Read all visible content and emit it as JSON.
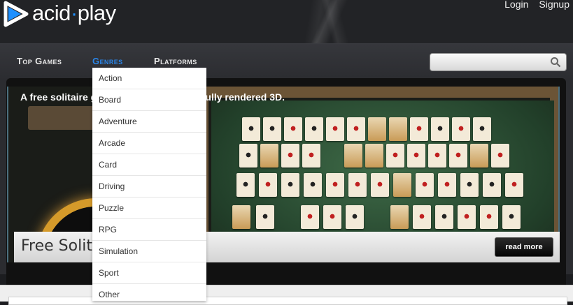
{
  "brand": {
    "name_part1": "acid",
    "name_part2": "play"
  },
  "auth": {
    "login": "Login",
    "signup": "Signup"
  },
  "nav": {
    "items": [
      {
        "label": "Top Games"
      },
      {
        "label": "Genres"
      },
      {
        "label": "Platforms"
      }
    ]
  },
  "search": {
    "placeholder": ""
  },
  "genres_menu": [
    "Action",
    "Board",
    "Adventure",
    "Arcade",
    "Card",
    "Driving",
    "Puzzle",
    "RPG",
    "Simulation",
    "Sport",
    "Other"
  ],
  "slide": {
    "tagline_visible_left": "A free solitaire g",
    "tagline_visible_right": "tifully rendered 3D.",
    "title": "Free Solita",
    "read_more": "read more"
  },
  "colors": {
    "accent": "#2a85e8",
    "logo_blue": "#1e90ff"
  },
  "icons": {
    "logo": "play-triangle-icon",
    "search": "search-icon"
  }
}
